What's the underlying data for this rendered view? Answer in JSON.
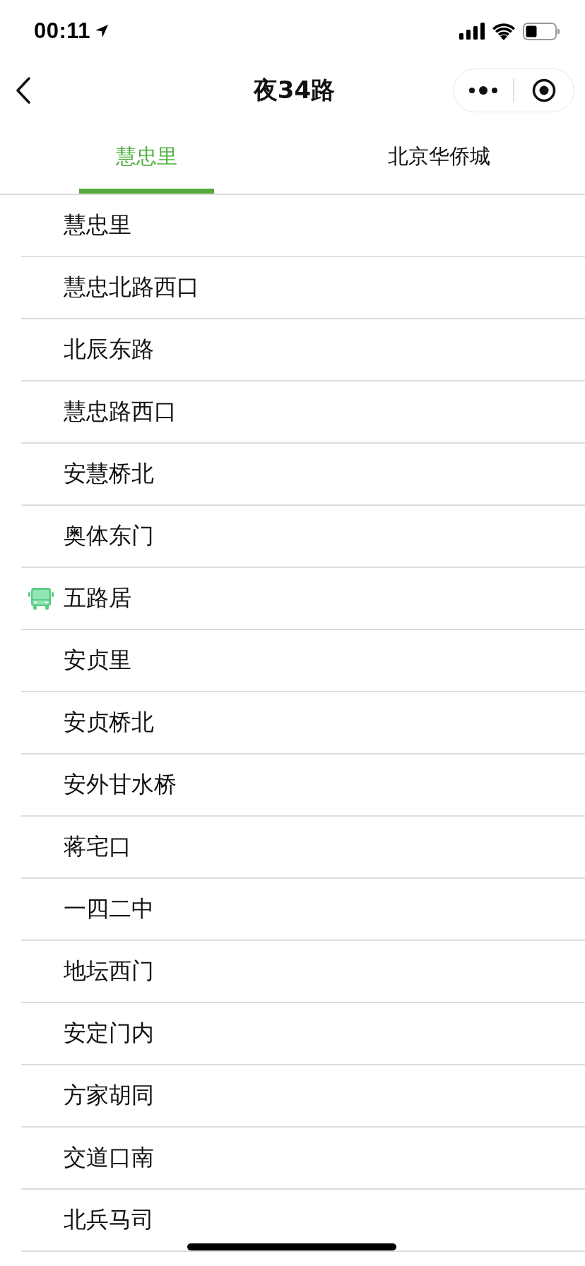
{
  "status_bar": {
    "time": "00:11"
  },
  "nav": {
    "title": "夜34路"
  },
  "tabs": [
    {
      "label": "慧忠里",
      "selected": true
    },
    {
      "label": "北京华侨城",
      "selected": false
    }
  ],
  "stops": [
    {
      "name": "慧忠里",
      "bus_here": false
    },
    {
      "name": "慧忠北路西口",
      "bus_here": false
    },
    {
      "name": "北辰东路",
      "bus_here": false
    },
    {
      "name": "慧忠路西口",
      "bus_here": false
    },
    {
      "name": "安慧桥北",
      "bus_here": false
    },
    {
      "name": "奥体东门",
      "bus_here": false
    },
    {
      "name": "五路居",
      "bus_here": true
    },
    {
      "name": "安贞里",
      "bus_here": false
    },
    {
      "name": "安贞桥北",
      "bus_here": false
    },
    {
      "name": "安外甘水桥",
      "bus_here": false
    },
    {
      "name": "蒋宅口",
      "bus_here": false
    },
    {
      "name": "一四二中",
      "bus_here": false
    },
    {
      "name": "地坛西门",
      "bus_here": false
    },
    {
      "name": "安定门内",
      "bus_here": false
    },
    {
      "name": "方家胡同",
      "bus_here": false
    },
    {
      "name": "交道口南",
      "bus_here": false
    },
    {
      "name": "北兵马司",
      "bus_here": false
    }
  ]
}
